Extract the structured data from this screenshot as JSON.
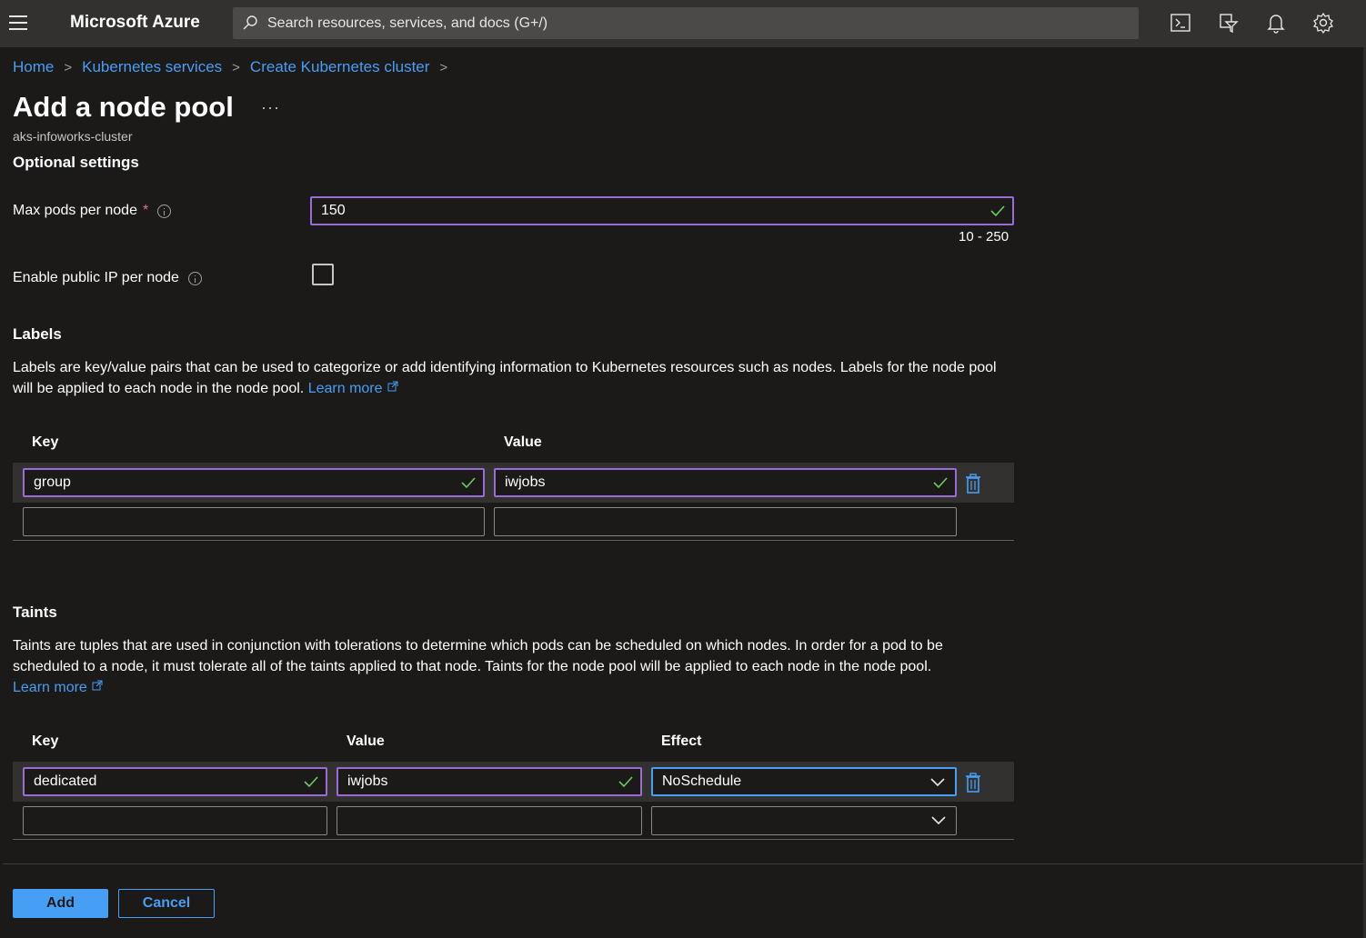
{
  "topbar": {
    "brand": "Microsoft Azure",
    "search_placeholder": "Search resources, services, and docs (G+/)",
    "icons": [
      "cloud-shell-icon",
      "directory-filter-icon",
      "notifications-icon",
      "settings-icon"
    ]
  },
  "breadcrumb": [
    "Home",
    "Kubernetes services",
    "Create Kubernetes cluster"
  ],
  "page": {
    "title": "Add a node pool",
    "more": "···",
    "subtitle": "aks-infoworks-cluster",
    "section": "Optional settings"
  },
  "max_pods": {
    "label": "Max pods per node",
    "required": "*",
    "value": "150",
    "range": "10 - 250"
  },
  "public_ip": {
    "label": "Enable public IP per node",
    "checked": false
  },
  "labels": {
    "title": "Labels",
    "description": "Labels are key/value pairs that can be used to categorize or add identifying information to Kubernetes resources such as nodes. Labels for the node pool will be applied to each node in the node pool.",
    "learn_more": "Learn more",
    "headers": [
      "Key",
      "Value"
    ],
    "rows": [
      {
        "key": "group",
        "value": "iwjobs"
      },
      {
        "key": "",
        "value": ""
      }
    ]
  },
  "taints": {
    "title": "Taints",
    "description": "Taints are tuples that are used in conjunction with tolerations to determine which pods can be scheduled on which nodes. In order for a pod to be scheduled to a node, it must tolerate all of the taints applied to that node. Taints for the node pool will be applied to each node in the node pool.",
    "learn_more": "Learn more",
    "headers": [
      "Key",
      "Value",
      "Effect"
    ],
    "rows": [
      {
        "key": "dedicated",
        "value": "iwjobs",
        "effect": "NoSchedule"
      },
      {
        "key": "",
        "value": "",
        "effect": ""
      }
    ]
  },
  "buttons": {
    "add": "Add",
    "cancel": "Cancel"
  },
  "colors": {
    "accent": "#479ef5",
    "valid_border": "#9b6bd6",
    "check": "#6ccb5f",
    "required": "#f1707b"
  }
}
